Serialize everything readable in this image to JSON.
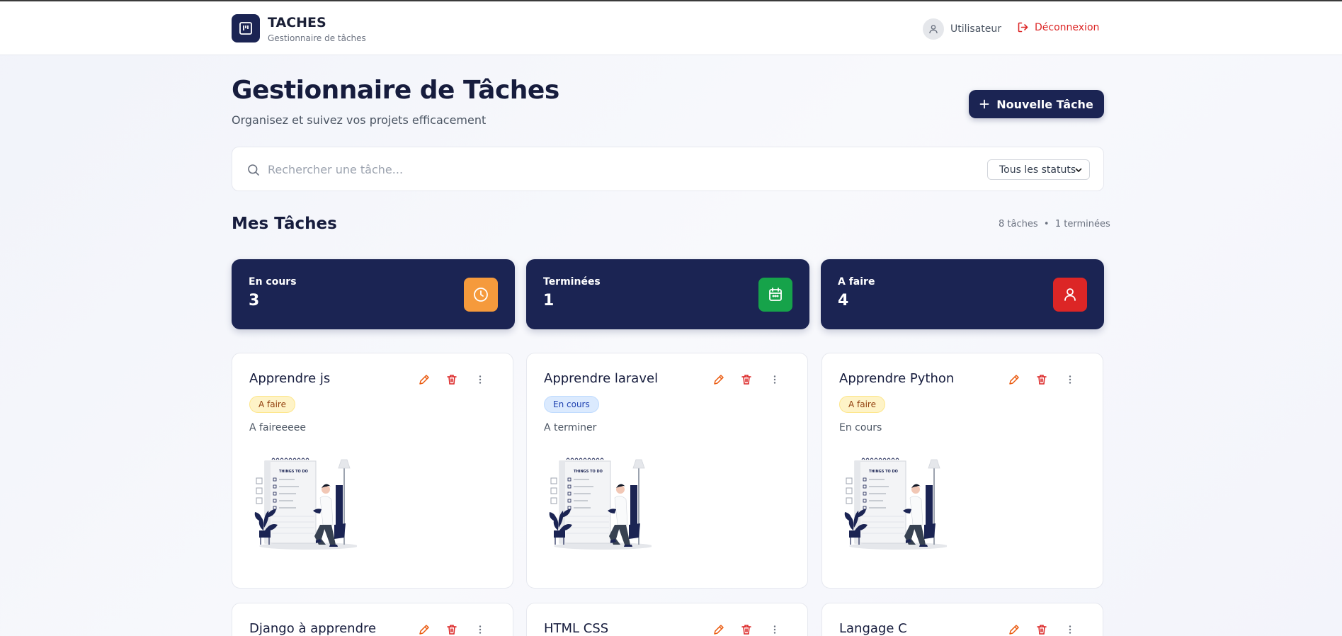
{
  "header": {
    "brand_title": "TACHES",
    "brand_subtitle": "Gestionnaire de tâches",
    "user_label": "Utilisateur",
    "logout_label": "Déconnexion"
  },
  "main": {
    "title": "Gestionnaire de Tâches",
    "subtitle": "Organisez et suivez vos projets efficacement",
    "new_task_label": "Nouvelle Tâche"
  },
  "search": {
    "placeholder": "Rechercher une tâche...",
    "value": "",
    "status_selected": "Tous les statuts"
  },
  "tasks_section": {
    "title": "Mes Tâches",
    "count_label": "8 tâches",
    "separator": "•",
    "done_label": "1 terminées"
  },
  "stats": [
    {
      "label": "En cours",
      "value": "3",
      "icon": "clock-icon",
      "color": "#f59a3c"
    },
    {
      "label": "Terminées",
      "value": "1",
      "icon": "calendar-icon",
      "color": "#16a34a"
    },
    {
      "label": "A faire",
      "value": "4",
      "icon": "user-icon",
      "color": "#dc2626"
    }
  ],
  "tasks": [
    {
      "title": "Apprendre js",
      "status": "A faire",
      "description": "A faireeeee",
      "image": "things-to-do-illustration"
    },
    {
      "title": "Apprendre laravel",
      "status": "En cours",
      "description": "A terminer",
      "image": "things-to-do-illustration"
    },
    {
      "title": "Apprendre Python",
      "status": "A faire",
      "description": "En cours",
      "image": "things-to-do-illustration"
    },
    {
      "title": "Django à apprendre"
    },
    {
      "title": "HTML CSS"
    },
    {
      "title": "Langage C"
    }
  ],
  "illustration_text": "THINGS TO DO",
  "colors": {
    "primary": "#1b2453",
    "danger": "#dc2626",
    "edit": "#ea580c"
  }
}
